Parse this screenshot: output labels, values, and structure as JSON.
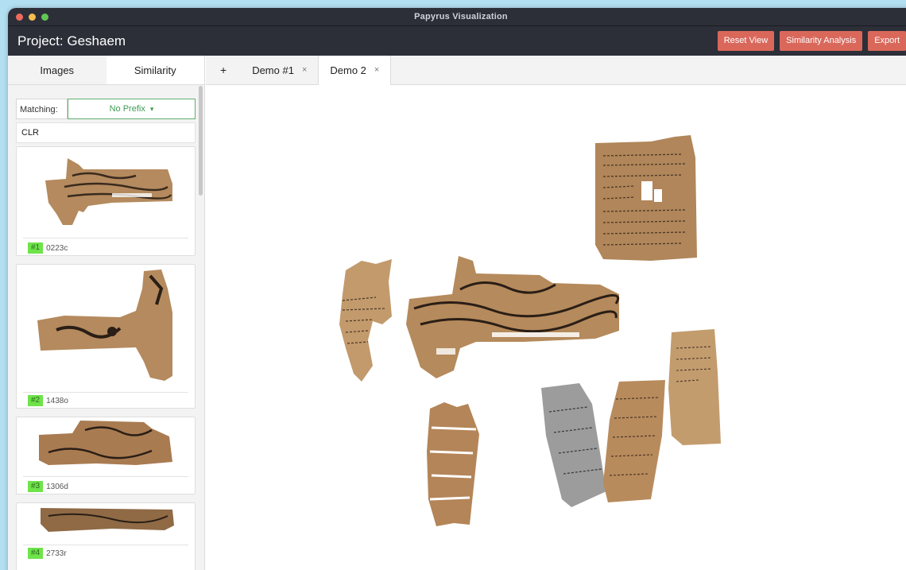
{
  "window": {
    "title": "Papyrus Visualization"
  },
  "header": {
    "project_title": "Project: Geshaem",
    "buttons": {
      "reset_view": "Reset View",
      "similarity_analysis": "Similarity Analysis",
      "export": "Export"
    }
  },
  "sidebar": {
    "tabs": [
      {
        "label": "Images",
        "active": false
      },
      {
        "label": "Similarity",
        "active": true
      }
    ],
    "matching": {
      "label": "Matching:",
      "selected": "No Prefix",
      "arrow": "▾"
    },
    "method": "CLR",
    "results": [
      {
        "rank": "#1",
        "id": "0223c"
      },
      {
        "rank": "#2",
        "id": "1438o"
      },
      {
        "rank": "#3",
        "id": "1306d"
      },
      {
        "rank": "#4",
        "id": "2733r"
      }
    ]
  },
  "main": {
    "tabs": [
      {
        "label": "+",
        "closable": false
      },
      {
        "label": "Demo #1",
        "closable": true,
        "close": "×"
      },
      {
        "label": "Demo 2",
        "closable": true,
        "close": "×",
        "active": true
      }
    ]
  },
  "colors": {
    "header_bg": "#2c2f38",
    "accent_button": "#d9685b",
    "rank_badge": "#6fe34a",
    "select_border": "#5fae6e",
    "papyrus": "#b48a5e"
  }
}
